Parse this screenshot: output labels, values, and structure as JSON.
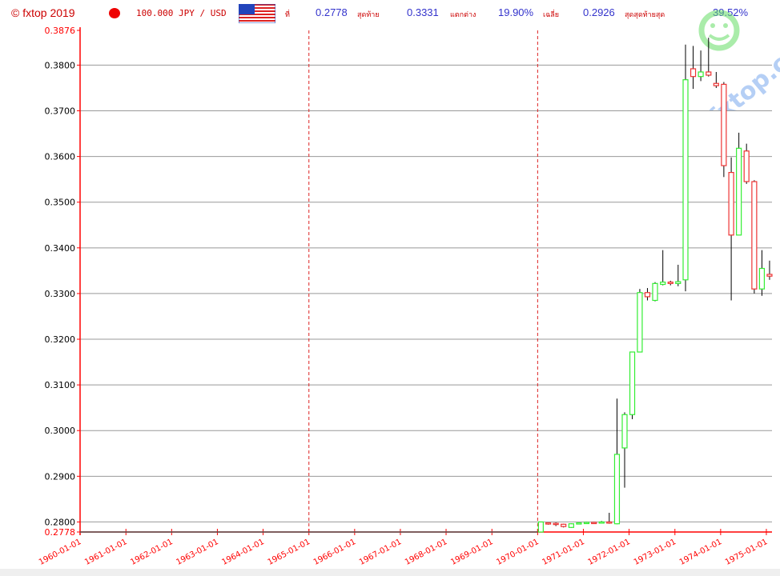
{
  "header": {
    "copyright": "© fxtop 2019",
    "pair": "100.000 JPY / USD",
    "start_label": "ที่",
    "start_value": "0.2778",
    "last_label": "สุดท้าย",
    "last_value": "0.3331",
    "change_label": "แตกต่าง",
    "change_value": "19.90%",
    "avg_label": "เฉลี่ย",
    "avg_value": "0.2926",
    "min_label": "สุดสุดท้ายสุด",
    "min_value": "39.52%"
  },
  "watermark": {
    "text": "fxtop.com"
  },
  "colors": {
    "up": "#33ee33",
    "down": "#ee3333",
    "wick": "#000000",
    "axis": "#ff0000",
    "grid": "#999999",
    "axis_label": "#ff0000",
    "tick_label": "#000000"
  },
  "chart_data": {
    "type": "candlestick",
    "title": "100.000 JPY / USD",
    "ylim": [
      0.2778,
      0.3876
    ],
    "y_ticks": [
      "0.3876",
      "0.3800",
      "0.3700",
      "0.3600",
      "0.3500",
      "0.3400",
      "0.3300",
      "0.3200",
      "0.3100",
      "0.3000",
      "0.2900",
      "0.2800",
      "0.2778"
    ],
    "x_ticks": [
      "1960-01-01",
      "1961-01-01",
      "1962-01-01",
      "1963-01-01",
      "1964-01-01",
      "1965-01-01",
      "1966-01-01",
      "1967-01-01",
      "1968-01-01",
      "1969-01-01",
      "1970-01-01",
      "1971-01-01",
      "1972-01-01",
      "1973-01-01",
      "1974-01-01",
      "1975-01-01"
    ],
    "x_range": [
      "1960-01-01",
      "1975-02-15"
    ],
    "vlines": [
      "1965-01-01",
      "1970-01-01"
    ],
    "grid": true,
    "flat_value": 0.2778,
    "candles": [
      {
        "date": "1970-01-01",
        "open": 0.2778,
        "high": 0.28,
        "low": 0.2778,
        "close": 0.28
      },
      {
        "date": "1970-03-01",
        "open": 0.2798,
        "high": 0.2799,
        "low": 0.2794,
        "close": 0.2797
      },
      {
        "date": "1970-05-01",
        "open": 0.2797,
        "high": 0.2799,
        "low": 0.2791,
        "close": 0.2795
      },
      {
        "date": "1970-07-01",
        "open": 0.2795,
        "high": 0.2796,
        "low": 0.2788,
        "close": 0.279
      },
      {
        "date": "1970-09-01",
        "open": 0.2788,
        "high": 0.2797,
        "low": 0.2787,
        "close": 0.2796
      },
      {
        "date": "1970-11-01",
        "open": 0.2796,
        "high": 0.2799,
        "low": 0.2795,
        "close": 0.2798
      },
      {
        "date": "1971-01-01",
        "open": 0.2798,
        "high": 0.28,
        "low": 0.2796,
        "close": 0.2799
      },
      {
        "date": "1971-03-01",
        "open": 0.2799,
        "high": 0.28,
        "low": 0.2797,
        "close": 0.2798
      },
      {
        "date": "1971-05-01",
        "open": 0.2798,
        "high": 0.2802,
        "low": 0.2797,
        "close": 0.28
      },
      {
        "date": "1971-07-01",
        "open": 0.28,
        "high": 0.282,
        "low": 0.2796,
        "close": 0.2798
      },
      {
        "date": "1971-09-01",
        "open": 0.2796,
        "high": 0.307,
        "low": 0.2795,
        "close": 0.2948
      },
      {
        "date": "1971-11-01",
        "open": 0.2962,
        "high": 0.304,
        "low": 0.2875,
        "close": 0.3035
      },
      {
        "date": "1972-01-01",
        "open": 0.3035,
        "high": 0.3043,
        "low": 0.3025,
        "close": 0.3172
      },
      {
        "date": "1972-03-01",
        "open": 0.3172,
        "high": 0.331,
        "low": 0.3172,
        "close": 0.3302
      },
      {
        "date": "1972-05-01",
        "open": 0.3302,
        "high": 0.3312,
        "low": 0.3285,
        "close": 0.3293
      },
      {
        "date": "1972-07-01",
        "open": 0.3285,
        "high": 0.3325,
        "low": 0.3283,
        "close": 0.3322
      },
      {
        "date": "1972-09-01",
        "open": 0.332,
        "high": 0.3395,
        "low": 0.3318,
        "close": 0.3325
      },
      {
        "date": "1972-11-01",
        "open": 0.3325,
        "high": 0.3328,
        "low": 0.3318,
        "close": 0.3322
      },
      {
        "date": "1973-01-01",
        "open": 0.3322,
        "high": 0.3363,
        "low": 0.3316,
        "close": 0.3326
      },
      {
        "date": "1973-03-01",
        "open": 0.333,
        "high": 0.3845,
        "low": 0.3305,
        "close": 0.3768
      },
      {
        "date": "1973-05-01",
        "open": 0.3792,
        "high": 0.3842,
        "low": 0.3748,
        "close": 0.3775
      },
      {
        "date": "1973-07-01",
        "open": 0.3775,
        "high": 0.3832,
        "low": 0.3765,
        "close": 0.3785
      },
      {
        "date": "1973-09-01",
        "open": 0.3785,
        "high": 0.386,
        "low": 0.3775,
        "close": 0.3778
      },
      {
        "date": "1973-11-01",
        "open": 0.376,
        "high": 0.3785,
        "low": 0.375,
        "close": 0.3755
      },
      {
        "date": "1974-01-01",
        "open": 0.3758,
        "high": 0.3763,
        "low": 0.3555,
        "close": 0.358
      },
      {
        "date": "1974-03-01",
        "open": 0.3565,
        "high": 0.3598,
        "low": 0.3285,
        "close": 0.3428
      },
      {
        "date": "1974-05-01",
        "open": 0.3428,
        "high": 0.3652,
        "low": 0.3428,
        "close": 0.3618
      },
      {
        "date": "1974-07-01",
        "open": 0.3612,
        "high": 0.3628,
        "low": 0.354,
        "close": 0.3545
      },
      {
        "date": "1974-09-01",
        "open": 0.3545,
        "high": 0.3548,
        "low": 0.33,
        "close": 0.331
      },
      {
        "date": "1974-11-01",
        "open": 0.331,
        "high": 0.3395,
        "low": 0.3295,
        "close": 0.3355
      },
      {
        "date": "1975-01-01",
        "open": 0.3342,
        "high": 0.3372,
        "low": 0.333,
        "close": 0.3338
      }
    ]
  }
}
